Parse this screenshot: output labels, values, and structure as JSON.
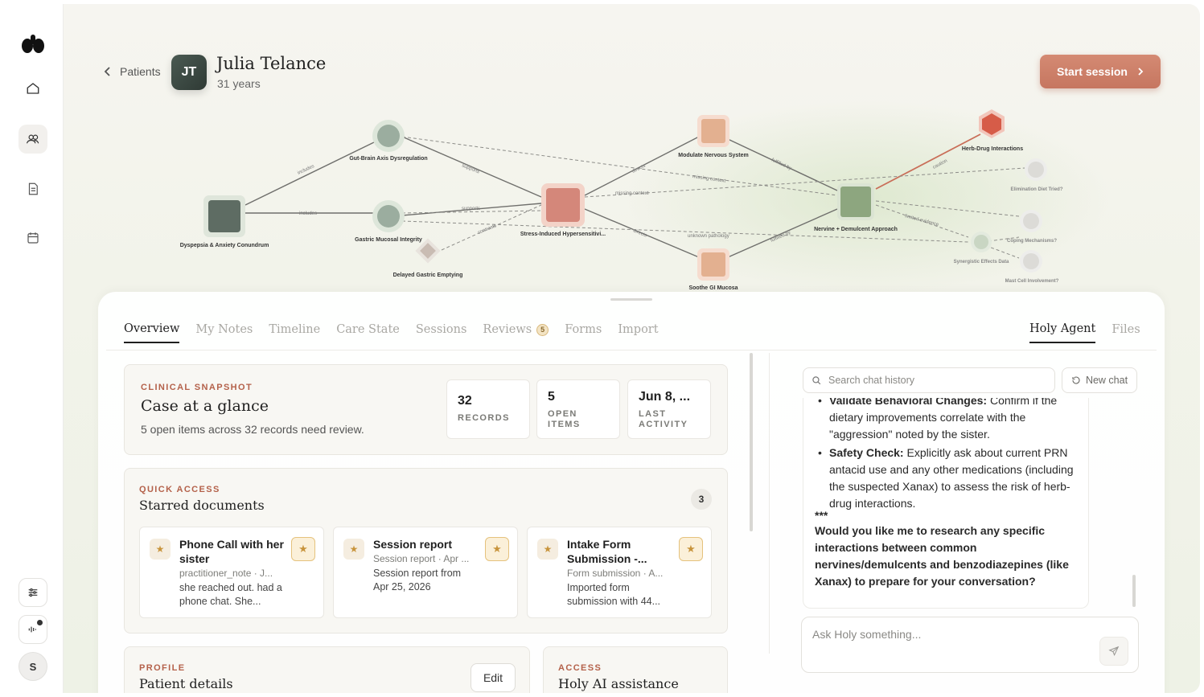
{
  "header": {
    "back_label": "Patients",
    "patient_initials": "JT",
    "patient_name": "Julia Telance",
    "patient_age": "31 years",
    "start_session_label": "Start session"
  },
  "graph": {
    "nodes": {
      "dyspepsia": "Dyspepsia & Anxiety Conundrum",
      "gut_brain": "Gut-Brain Axis Dysregulation",
      "gastric_mucosal": "Gastric Mucosal Integrity",
      "delayed_gastric": "Delayed Gastric Emptying",
      "stress_induced": "Stress-Induced Hypersensitivi...",
      "modulate_nervous": "Modulate Nervous System",
      "soothe_gi": "Soothe GI Mucosa",
      "nervine": "Nervine + Demulcent Approach",
      "herb_drug": "Herb-Drug Interactions",
      "elimination_diet": "Elimination Diet Tried?",
      "coping": "Coping Mechanisms?",
      "synergistic": "Synergistic Effects Data",
      "mast_cell": "Mast Cell Involvement?"
    },
    "edges": {
      "includes_1": "includes",
      "includes_2": "includes",
      "supports_1": "supports",
      "supports_2": "supports",
      "contrasts": "contrasts",
      "missing_context_1": "missing context",
      "missing_context_2": "missing context",
      "unknown_pathology": "unknown pathology",
      "directs_1": "directs",
      "directs_2": "directs",
      "fulfilled_by_1": "fulfilled by",
      "fulfilled_by_2": "fulfilled by",
      "caution": "caution",
      "limited_evidence": "limited evidence"
    }
  },
  "tabs": [
    {
      "label": "Overview"
    },
    {
      "label": "My Notes"
    },
    {
      "label": "Timeline"
    },
    {
      "label": "Care State"
    },
    {
      "label": "Sessions"
    },
    {
      "label": "Reviews",
      "badge": "5"
    },
    {
      "label": "Forms"
    },
    {
      "label": "Import"
    }
  ],
  "right_tabs": [
    {
      "label": "Holy Agent"
    },
    {
      "label": "Files"
    }
  ],
  "snapshot": {
    "eyebrow": "CLINICAL SNAPSHOT",
    "title": "Case at a glance",
    "subtitle": "5 open items across 32 records need review.",
    "stats": [
      {
        "value": "32",
        "label": "RECORDS"
      },
      {
        "value": "5",
        "label": "OPEN ITEMS"
      },
      {
        "value": "Jun 8, ...",
        "label": "LAST ACTIVITY"
      }
    ]
  },
  "quick_access": {
    "eyebrow": "QUICK ACCESS",
    "title": "Starred documents",
    "count": "3",
    "docs": [
      {
        "title": "Phone Call with her sister",
        "meta": "practitioner_note · J...",
        "desc": "she reached out. had a phone chat. She..."
      },
      {
        "title": "Session report",
        "meta": "Session report · Apr ...",
        "desc": "Session report from Apr 25, 2026"
      },
      {
        "title": "Intake Form Submission -...",
        "meta": "Form submission · A...",
        "desc": "Imported form submission with 44..."
      }
    ]
  },
  "profile": {
    "eyebrow": "PROFILE",
    "title": "Patient details",
    "edit_label": "Edit"
  },
  "access": {
    "eyebrow": "ACCESS",
    "title": "Holy AI assistance"
  },
  "chat": {
    "search_placeholder": "Search chat history",
    "new_chat_label": "New chat",
    "bullets": [
      {
        "bold": "Validate Behavioral Changes:",
        "text": " Confirm if the dietary improvements correlate with the \"aggression\" noted by the sister."
      },
      {
        "bold": "Safety Check:",
        "text": " Explicitly ask about current PRN antacid use and any other medications (including the suspected Xanax) to assess the risk of herb-drug interactions."
      }
    ],
    "separator": "***",
    "question": "Would you like me to research any specific interactions between common nervines/demulcents and benzodiazepines (like Xanax) to prepare for your conversation?",
    "input_placeholder": "Ask Holy something..."
  },
  "sidebar": {
    "user_initial": "S"
  }
}
